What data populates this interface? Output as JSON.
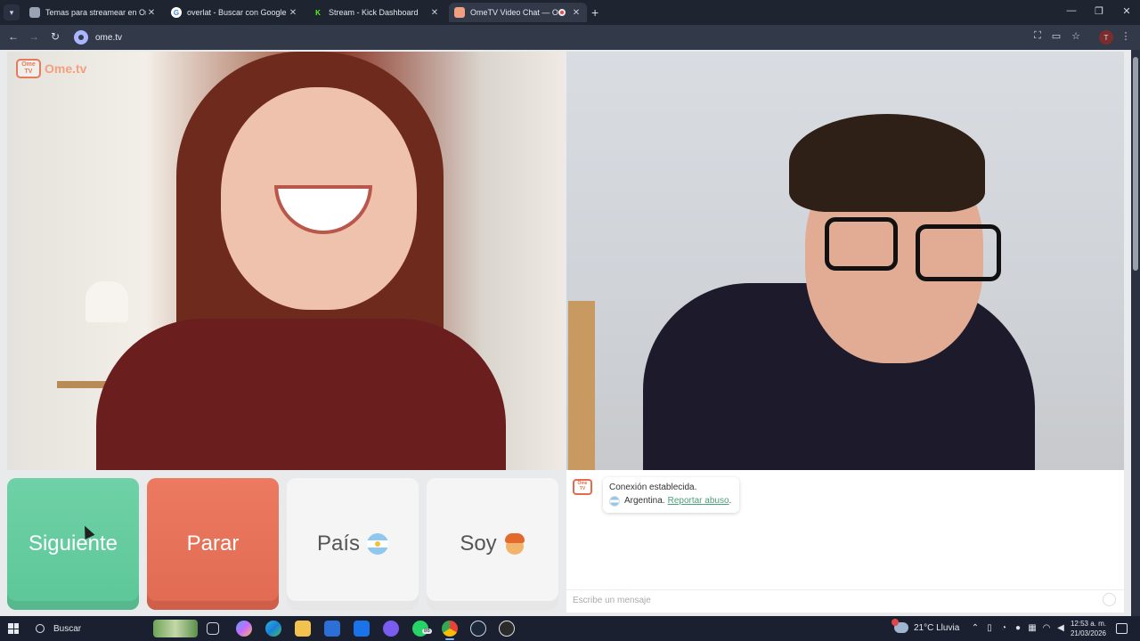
{
  "browser": {
    "tabs": [
      {
        "title": "Temas para streamear en Omeg",
        "favicon": "globe-icon",
        "active": false
      },
      {
        "title": "overlat - Buscar con Google",
        "favicon": "google-icon",
        "active": false
      },
      {
        "title": "Stream - Kick Dashboard",
        "favicon": "kick-icon",
        "active": false
      },
      {
        "title": "OmeTV Video Chat — Ome",
        "favicon": "ometv-icon",
        "active": true
      }
    ],
    "url": "ome.tv",
    "profile_initial": "T"
  },
  "ometv": {
    "logo_text": "Ome.tv",
    "logo_badge": "Ome TV",
    "buttons": {
      "next": "Siguiente",
      "stop": "Parar",
      "country": "País",
      "gender": "Soy"
    },
    "chat": {
      "status": "Conexión establecida.",
      "country": "Argentina.",
      "report_link": "Reportar abuso",
      "report_suffix": ".",
      "input_placeholder": "Escribe un mensaje"
    }
  },
  "taskbar": {
    "search_label": "Buscar",
    "whatsapp_badge": "86",
    "weather": "21°C  Lluvia",
    "time": "12:53 a. m.",
    "date": "21/03/2026"
  },
  "colors": {
    "next_button": "#6fd1a7",
    "stop_button": "#ec7a60",
    "brand": "#e67a5a",
    "link": "#4a9e7c"
  }
}
